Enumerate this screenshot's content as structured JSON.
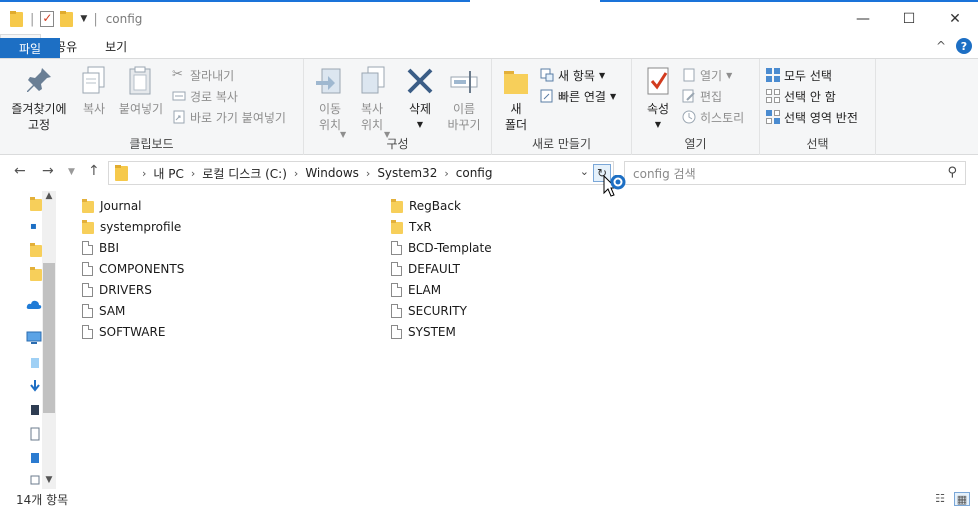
{
  "title": {
    "path_text": "config"
  },
  "window": {
    "minimize": "—",
    "maximize": "☐",
    "close": "✕",
    "collapse": "^",
    "help": "?"
  },
  "tabs": [
    {
      "label": "파일"
    },
    {
      "label": "홈"
    },
    {
      "label": "공유"
    },
    {
      "label": "보기"
    }
  ],
  "ribbon": {
    "clipboard": {
      "pin": "즐겨찾기에\n고정",
      "copy": "복사",
      "paste": "붙여넣기",
      "cut": "잘라내기",
      "copy_path": "경로 복사",
      "paste_shortcut": "바로 가기 붙여넣기",
      "label": "클립보드"
    },
    "organize": {
      "move": "이동\n위치",
      "copy_to": "복사\n위치",
      "delete": "삭제",
      "rename": "이름\n바꾸기",
      "label": "구성"
    },
    "new": {
      "new_folder": "새\n폴더",
      "new_item": "새 항목",
      "easy_access": "빠른 연결",
      "label": "새로 만들기"
    },
    "open": {
      "properties": "속성",
      "open": "열기",
      "edit": "편집",
      "history": "히스토리",
      "label": "열기"
    },
    "select": {
      "select_all": "모두 선택",
      "select_none": "선택 안 함",
      "invert": "선택 영역 반전",
      "label": "선택"
    }
  },
  "address": {
    "crumbs": [
      "내 PC",
      "로컬 디스크 (C:)",
      "Windows",
      "System32",
      "config"
    ]
  },
  "search": {
    "placeholder": "config 검색"
  },
  "files": {
    "left": [
      {
        "name": "Journal",
        "type": "folder"
      },
      {
        "name": "systemprofile",
        "type": "folder"
      },
      {
        "name": "BBI",
        "type": "file"
      },
      {
        "name": "COMPONENTS",
        "type": "file"
      },
      {
        "name": "DRIVERS",
        "type": "file"
      },
      {
        "name": "SAM",
        "type": "file"
      },
      {
        "name": "SOFTWARE",
        "type": "file"
      }
    ],
    "right": [
      {
        "name": "RegBack",
        "type": "folder"
      },
      {
        "name": "TxR",
        "type": "folder"
      },
      {
        "name": "BCD-Template",
        "type": "file"
      },
      {
        "name": "DEFAULT",
        "type": "file"
      },
      {
        "name": "ELAM",
        "type": "file"
      },
      {
        "name": "SECURITY",
        "type": "file"
      },
      {
        "name": "SYSTEM",
        "type": "file"
      }
    ]
  },
  "status": {
    "count": "14개 항목"
  },
  "colors": {
    "accent": "#1d6fc4",
    "folder": "#f7cf5a",
    "ribbon_bg": "#f5f6f7"
  }
}
